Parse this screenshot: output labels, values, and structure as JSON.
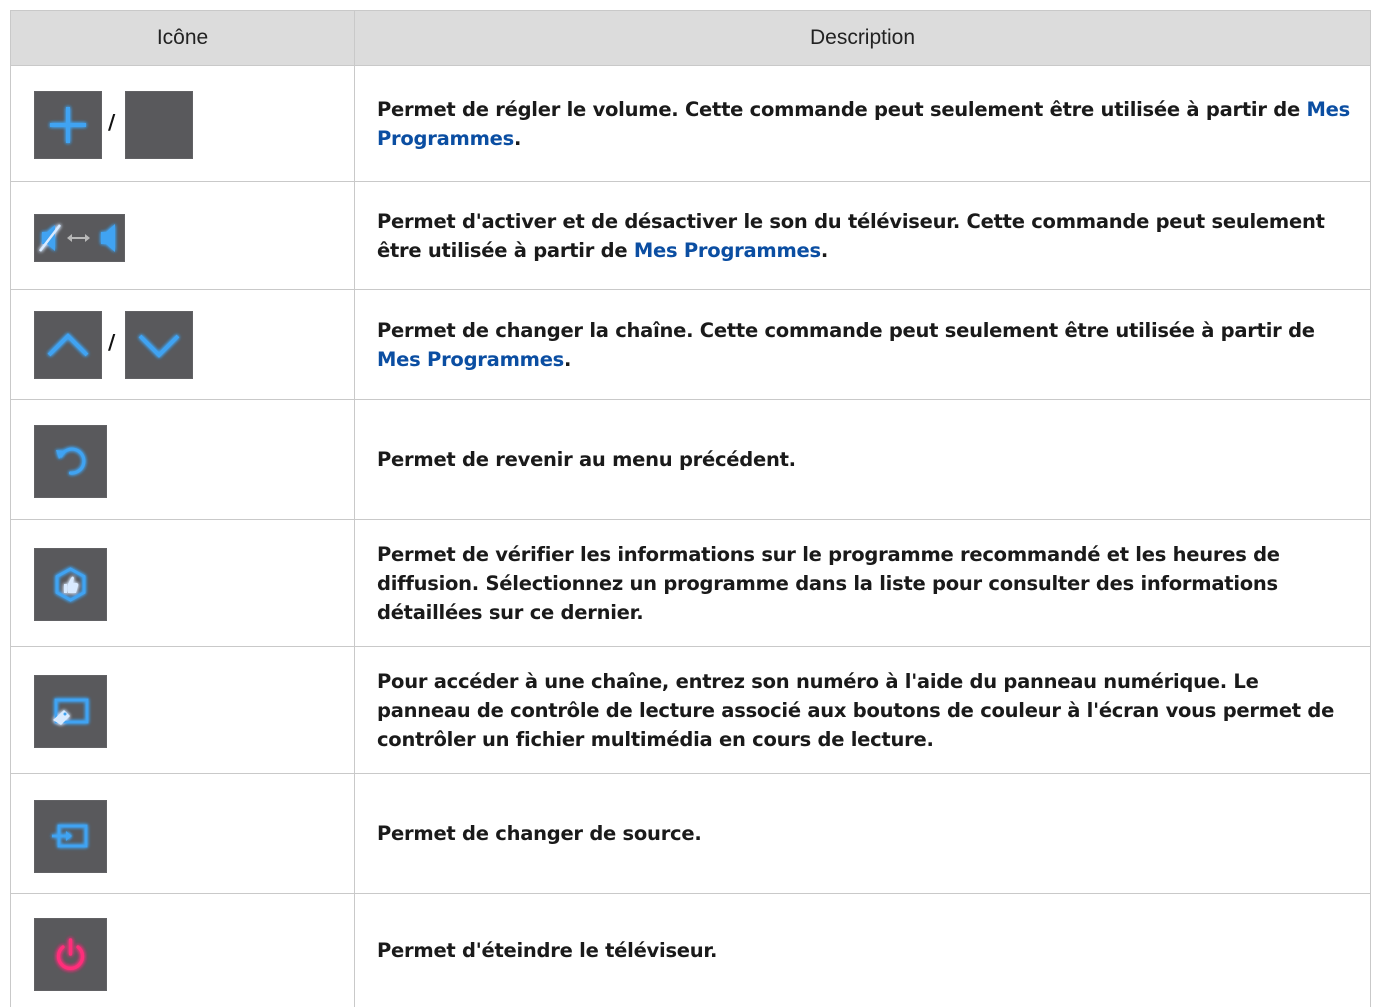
{
  "table": {
    "headers": {
      "icon": "Icône",
      "description": "Description"
    },
    "separator": "/",
    "rows": [
      {
        "icons": [
          "plus-icon",
          "minus-icon"
        ],
        "text_1": "Permet de régler le volume. Cette commande peut seulement être utilisée à partir de ",
        "keyword": "Mes Programmes",
        "text_2": "."
      },
      {
        "icons": [
          "mute-toggle-icon"
        ],
        "text_1": "Permet d'activer et de désactiver le son du téléviseur. Cette commande peut seulement être utilisée à partir de ",
        "keyword": "Mes Programmes",
        "text_2": "."
      },
      {
        "icons": [
          "chevron-up-icon",
          "chevron-down-icon"
        ],
        "text_1": "Permet de changer la chaîne. Cette commande peut seulement être utilisée à partir de ",
        "keyword": "Mes Programmes",
        "text_2": "."
      },
      {
        "icons": [
          "return-icon"
        ],
        "text": "Permet de revenir au menu précédent."
      },
      {
        "icons": [
          "recommended-icon"
        ],
        "text": "Permet de vérifier les informations sur le programme recommandé et les heures de diffusion. Sélectionnez un programme dans la liste pour consulter des informations détaillées sur ce dernier."
      },
      {
        "icons": [
          "screen-remote-icon"
        ],
        "text": "Pour accéder à une chaîne, entrez son numéro à l'aide du panneau numérique. Le panneau de contrôle de lecture associé aux boutons de couleur à l'écran vous permet de contrôler un fichier multimédia en cours de lecture."
      },
      {
        "icons": [
          "source-icon"
        ],
        "text": "Permet de changer de source."
      },
      {
        "icons": [
          "power-icon"
        ],
        "text": "Permet d'éteindre le téléviseur."
      }
    ]
  },
  "colors": {
    "header_bg": "#dcdcdc",
    "grid_line": "#c9c9c9",
    "button_bg": "#59595c",
    "icon_blue": "#3fa3f2",
    "power_pink": "#ff2d7a",
    "keyword_blue": "#0b4ea2"
  }
}
